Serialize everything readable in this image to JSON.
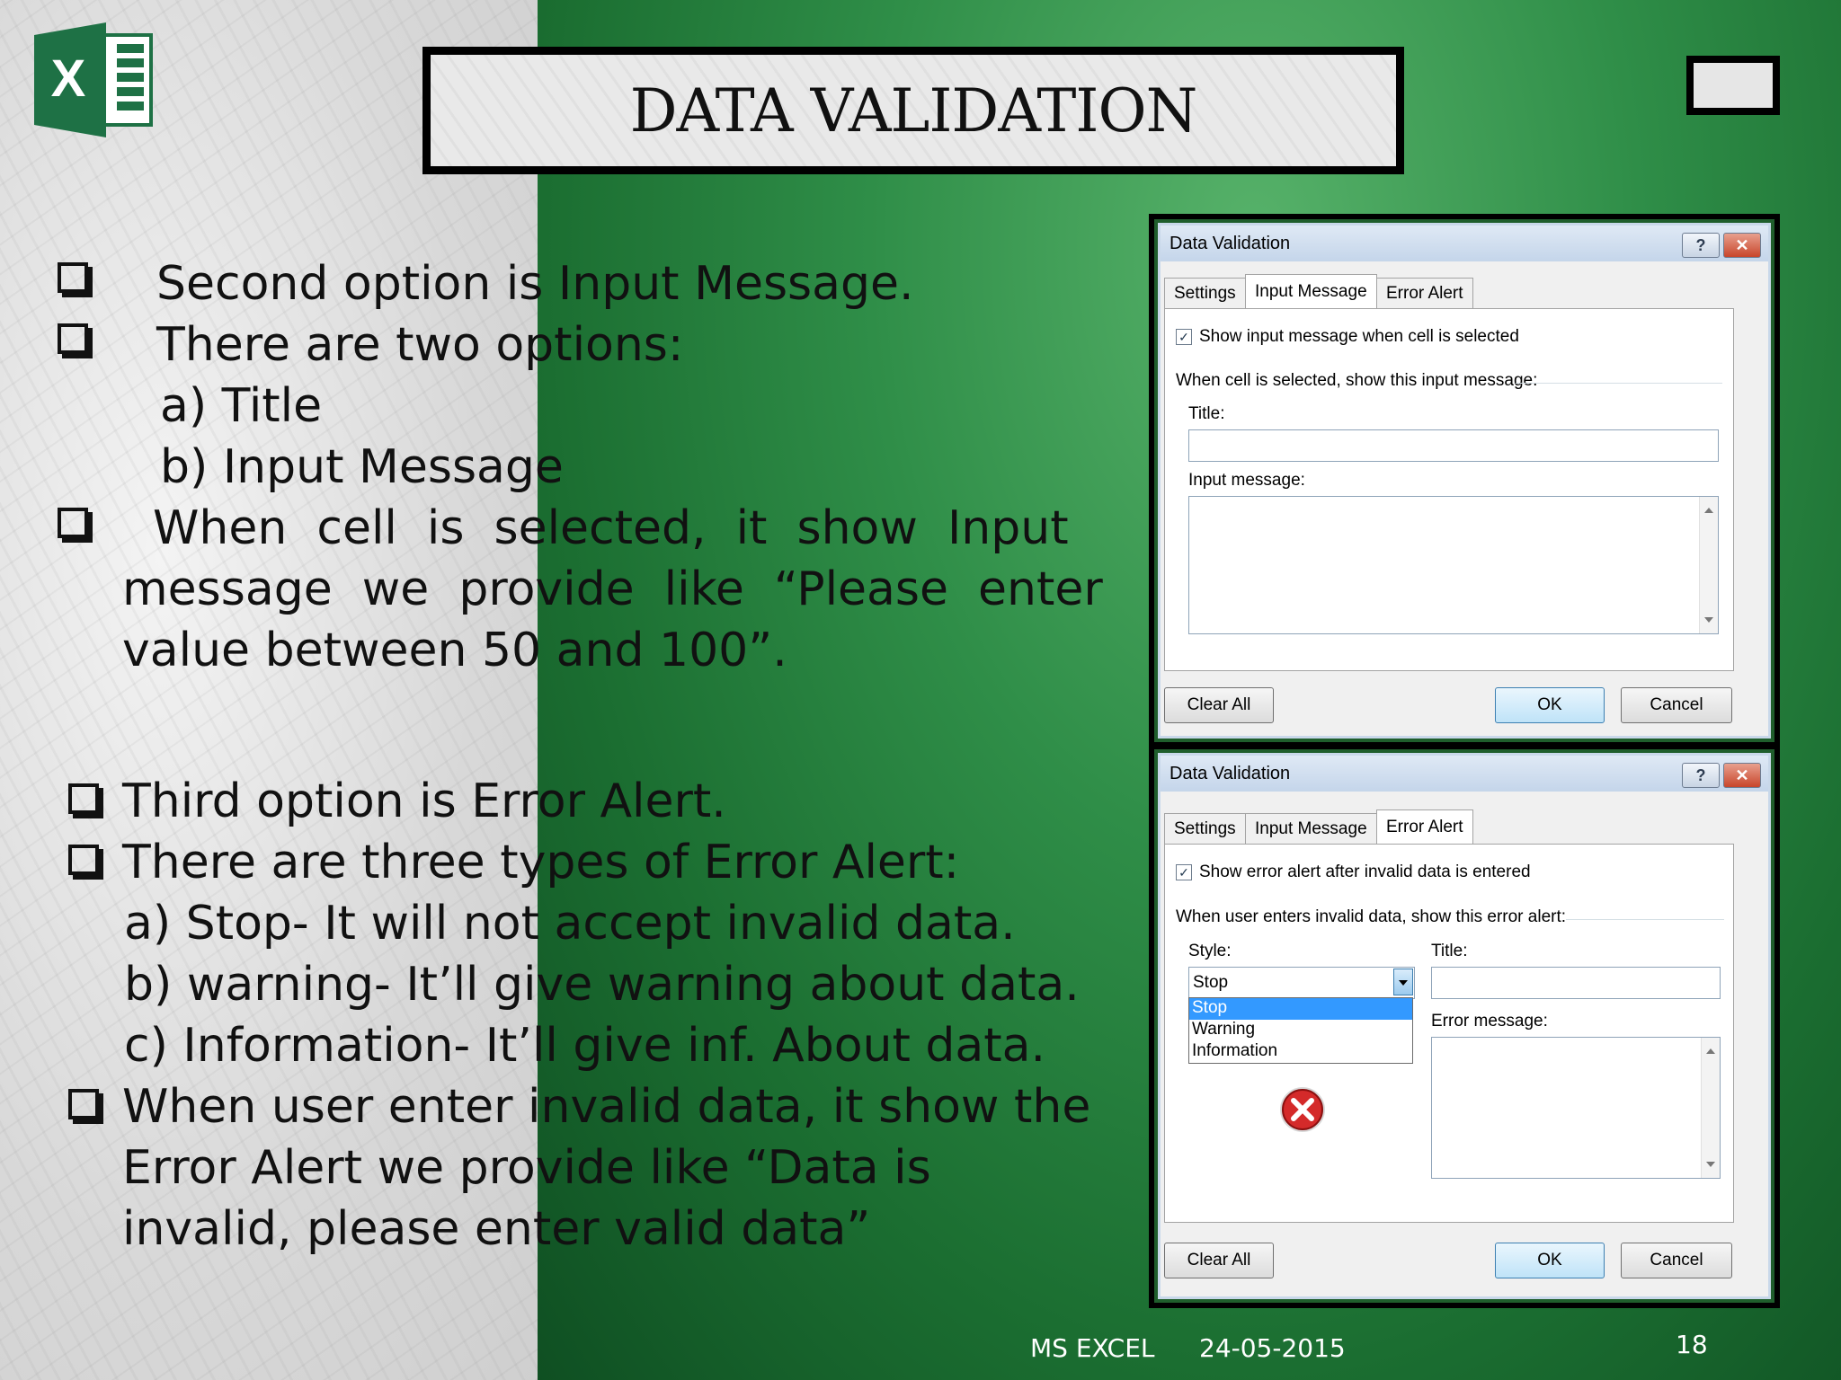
{
  "slide": {
    "title": "DATA VALIDATION",
    "logo_letter": "X",
    "paragraphs": [
      "Second option is Input Message.",
      "There are two options:",
      "a) Title",
      "b) Input Message",
      "When  cell  is  selected,  it  show  Input",
      "message  we  provide  like  “Please  enter",
      "value between 50 and 100”.",
      "Third option is Error Alert.",
      "There are three types of Error Alert:",
      "a) Stop- It will not accept invalid data.",
      "b) warning- It’ll give warning about data.",
      "c) Information- It’ll give inf. About data.",
      "When user enter invalid data, it show the",
      "Error Alert we provide like “Data is",
      "invalid, please enter valid data”"
    ]
  },
  "dialog1": {
    "title": "Data Validation",
    "help_label": "?",
    "close_label": "✕",
    "tabs": [
      "Settings",
      "Input Message",
      "Error Alert"
    ],
    "checkbox_label": "Show input message when cell is selected",
    "checkbox_mark": "✓",
    "section_label": "When cell is selected, show this input message:",
    "title_label": "Title:",
    "message_label": "Input message:",
    "clear_label": "Clear All",
    "ok_label": "OK",
    "cancel_label": "Cancel"
  },
  "dialog2": {
    "title": "Data Validation",
    "help_label": "?",
    "close_label": "✕",
    "tabs": [
      "Settings",
      "Input Message",
      "Error Alert"
    ],
    "checkbox_label": "Show error alert after invalid data is entered",
    "checkbox_mark": "✓",
    "section_label": "When user enters invalid data, show this error alert:",
    "style_label": "Style:",
    "style_value": "Stop",
    "style_options": [
      "Stop",
      "Warning",
      "Information"
    ],
    "title_label": "Title:",
    "error_message_label": "Error message:",
    "clear_label": "Clear All",
    "ok_label": "OK",
    "cancel_label": "Cancel"
  },
  "footer": {
    "left": "MS EXCEL",
    "date": "24-05-2015",
    "page": "18"
  }
}
